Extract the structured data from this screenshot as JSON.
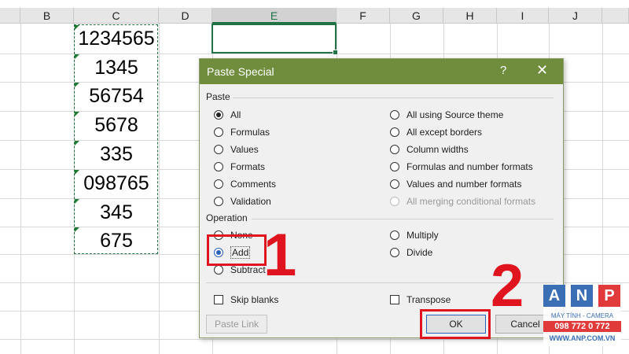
{
  "columns": [
    {
      "label": "B",
      "active": false
    },
    {
      "label": "C",
      "active": false
    },
    {
      "label": "D",
      "active": false
    },
    {
      "label": "E",
      "active": true
    },
    {
      "label": "F",
      "active": false
    },
    {
      "label": "G",
      "active": false
    },
    {
      "label": "H",
      "active": false
    },
    {
      "label": "I",
      "active": false
    },
    {
      "label": "J",
      "active": false
    }
  ],
  "cells_c": [
    "1234565",
    "1345",
    "56754",
    "5678",
    "335",
    "098765",
    "345",
    "675"
  ],
  "dialog": {
    "title": "Paste Special",
    "help": "?",
    "close": "✕",
    "paste_section": "Paste",
    "paste_left": [
      "All",
      "Formulas",
      "Values",
      "Formats",
      "Comments",
      "Validation"
    ],
    "paste_right": [
      "All using Source theme",
      "All except borders",
      "Column widths",
      "Formulas and number formats",
      "Values and number formats",
      "All merging conditional formats"
    ],
    "paste_selected": "All",
    "operation_section": "Operation",
    "operation_left": [
      "None",
      "Add",
      "Subtract"
    ],
    "operation_right": [
      "Multiply",
      "Divide"
    ],
    "operation_selected": "Add",
    "skip_blanks": "Skip blanks",
    "transpose": "Transpose",
    "paste_link": "Paste Link",
    "ok": "OK",
    "cancel": "Cancel"
  },
  "annotations": {
    "step1": "1",
    "step2": "2"
  },
  "watermark": {
    "letters": [
      "A",
      "N",
      "P"
    ],
    "line1": "MÁY TÍNH - CAMERA",
    "phone": "098 772 0 772",
    "site": "WWW.ANP.COM.VN"
  },
  "colors": {
    "excel_green": "#217346",
    "dialog_title": "#6f8d3d",
    "annotation_red": "#e0141e",
    "logo_blue": "#3a6fb5",
    "logo_red": "#e03a3a"
  }
}
